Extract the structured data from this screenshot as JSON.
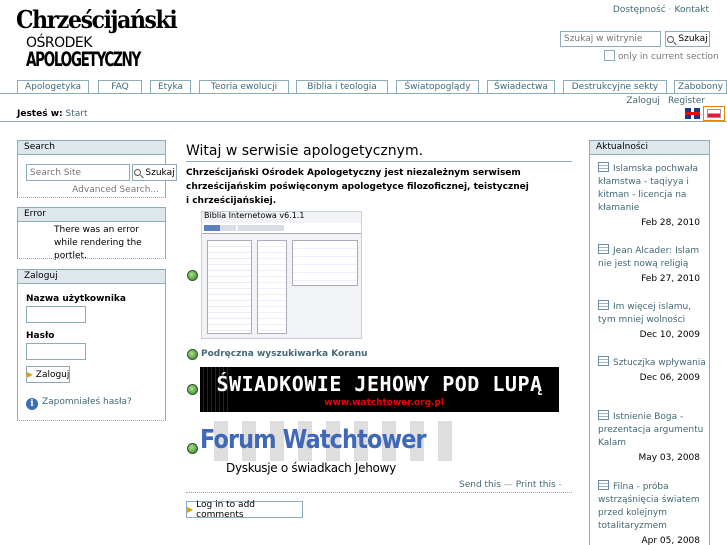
{
  "logo": {
    "line1": "Chrześcijański",
    "line2": "OŚRODEK",
    "line3": "APOLOGETYCZNY"
  },
  "site_actions": [
    "Dostępność",
    "Kontakt"
  ],
  "search": {
    "placeholder": "Szukaj w witrynie",
    "button": "Szukaj",
    "only_current": "only in current section"
  },
  "tabs": [
    "Apologetyka",
    "FAQ",
    "Etyka",
    "Teoria ewolucji",
    "Biblia i teologia",
    "Światopoglądy",
    "Świadectwa",
    "Destrukcyjne sekty",
    "Zabobony"
  ],
  "personal": {
    "login": "Zaloguj",
    "register": "Register"
  },
  "breadcrumb": {
    "label": "Jesteś w:",
    "item": "Start"
  },
  "portlet_search": {
    "title": "Search",
    "placeholder": "Search Site",
    "button": "Szukaj",
    "advanced": "Advanced Search..."
  },
  "portlet_error": {
    "title": "Error",
    "message": "There was an error while rendering the portlet."
  },
  "portlet_login": {
    "title": "Zaloguj",
    "username_label": "Nazwa użytkownika",
    "password_label": "Hasło",
    "button": "Zaloguj",
    "forgot": "Zapomniałeś hasła?"
  },
  "main": {
    "title": "Witaj w serwisie apologetycznym.",
    "intro": "Chrześcijański Ośrodek Apologetyczny jest niezależnym serwisem chrześcijańskim poświęconym apologetyce filozoficznej, teistycznej i chrześcijańskiej.",
    "shot_title": "Biblia Internetowa v6.1.1",
    "koran_link": "Podręczna wyszukiwarka Koranu",
    "banner1_title": "ŚWIADKOWIE JEHOWY POD LUPĄ",
    "banner1_url": "www.watchtower.org.pl",
    "banner2_title": "Forum Watchtower",
    "banner2_subtitle": "Dyskusje o świadkach Jehowy",
    "send_this": "Send this",
    "print_this": "Print this",
    "comments_button": "Log in to add comments"
  },
  "news": {
    "title": "Aktualności",
    "items": [
      {
        "title": "Islamska pochwała kłamstwa - taqiyya i kitman - licencja na kłamanie",
        "date": "Feb 28, 2010"
      },
      {
        "title": "Jean Alcader: Islam nie jest nową religią",
        "date": "Feb 27, 2010"
      },
      {
        "title": "Im więcej islamu, tym mniej wolności",
        "date": "Dec 10, 2009"
      },
      {
        "title": "Sztuczjka wpływania",
        "date": "Dec 06, 2009"
      },
      {
        "title": "Istnienie Boga - prezentacja argumentu Kalam",
        "date": "May 03, 2008"
      },
      {
        "title": "Filna - próba wstrząśnięcia światem przed kolejnym totalitaryzmem",
        "date": "Apr 05, 2008"
      }
    ]
  }
}
